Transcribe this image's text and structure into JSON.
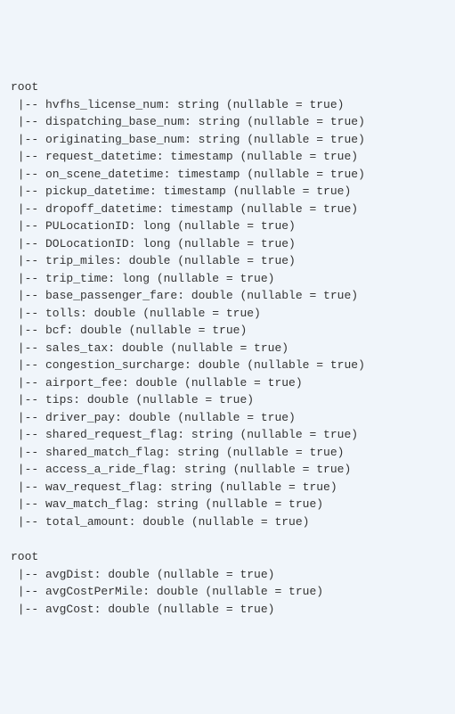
{
  "root_label": "root",
  "tree_prefix": " |-- ",
  "nullable_suffix": "(nullable = true)",
  "schemas": [
    {
      "fields": [
        {
          "name": "hvfhs_license_num",
          "type": "string"
        },
        {
          "name": "dispatching_base_num",
          "type": "string"
        },
        {
          "name": "originating_base_num",
          "type": "string"
        },
        {
          "name": "request_datetime",
          "type": "timestamp"
        },
        {
          "name": "on_scene_datetime",
          "type": "timestamp"
        },
        {
          "name": "pickup_datetime",
          "type": "timestamp"
        },
        {
          "name": "dropoff_datetime",
          "type": "timestamp"
        },
        {
          "name": "PULocationID",
          "type": "long"
        },
        {
          "name": "DOLocationID",
          "type": "long"
        },
        {
          "name": "trip_miles",
          "type": "double"
        },
        {
          "name": "trip_time",
          "type": "long"
        },
        {
          "name": "base_passenger_fare",
          "type": "double"
        },
        {
          "name": "tolls",
          "type": "double"
        },
        {
          "name": "bcf",
          "type": "double"
        },
        {
          "name": "sales_tax",
          "type": "double"
        },
        {
          "name": "congestion_surcharge",
          "type": "double"
        },
        {
          "name": "airport_fee",
          "type": "double"
        },
        {
          "name": "tips",
          "type": "double"
        },
        {
          "name": "driver_pay",
          "type": "double"
        },
        {
          "name": "shared_request_flag",
          "type": "string"
        },
        {
          "name": "shared_match_flag",
          "type": "string"
        },
        {
          "name": "access_a_ride_flag",
          "type": "string"
        },
        {
          "name": "wav_request_flag",
          "type": "string"
        },
        {
          "name": "wav_match_flag",
          "type": "string"
        },
        {
          "name": "total_amount",
          "type": "double"
        }
      ]
    },
    {
      "fields": [
        {
          "name": "avgDist",
          "type": "double"
        },
        {
          "name": "avgCostPerMile",
          "type": "double"
        },
        {
          "name": "avgCost",
          "type": "double"
        }
      ]
    }
  ]
}
